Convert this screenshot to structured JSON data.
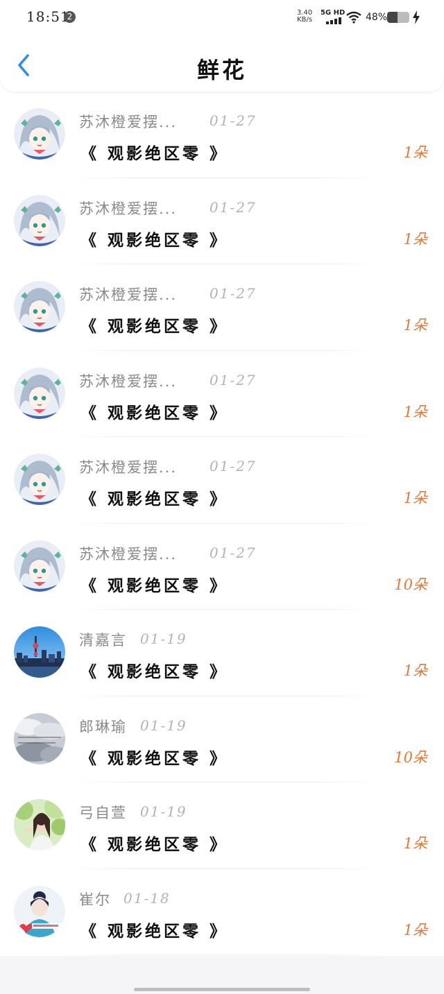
{
  "status_bar": {
    "time": "18:51",
    "notification_count": "2",
    "net_speed_value": "3.40",
    "net_speed_unit": "KB/s",
    "network": "5G HD",
    "battery_percent": "48%",
    "battery_level": 0.48,
    "charging": true
  },
  "header": {
    "title": "鲜花",
    "back_icon": "chevron-left-icon"
  },
  "colors": {
    "accent_back": "#2f8fe0",
    "count_orange": "#e07a3b",
    "name_gray": "#8a8a8a",
    "date_gray": "#b3b3b3"
  },
  "records": [
    {
      "user": "苏沐橙爱摆...",
      "date": "01-27",
      "title": "《 观影绝区零 》",
      "count": "1朵",
      "avatar": "anime-girl-avatar"
    },
    {
      "user": "苏沐橙爱摆...",
      "date": "01-27",
      "title": "《 观影绝区零 》",
      "count": "1朵",
      "avatar": "anime-girl-avatar"
    },
    {
      "user": "苏沐橙爱摆...",
      "date": "01-27",
      "title": "《 观影绝区零 》",
      "count": "1朵",
      "avatar": "anime-girl-avatar"
    },
    {
      "user": "苏沐橙爱摆...",
      "date": "01-27",
      "title": "《 观影绝区零 》",
      "count": "1朵",
      "avatar": "anime-girl-avatar"
    },
    {
      "user": "苏沐橙爱摆...",
      "date": "01-27",
      "title": "《 观影绝区零 》",
      "count": "1朵",
      "avatar": "anime-girl-avatar"
    },
    {
      "user": "苏沐橙爱摆...",
      "date": "01-27",
      "title": "《 观影绝区零 》",
      "count": "10朵",
      "avatar": "anime-girl-avatar"
    },
    {
      "user": "清嘉言",
      "date": "01-19",
      "title": "《 观影绝区零 》",
      "count": "1朵",
      "avatar": "city-skyline-avatar"
    },
    {
      "user": "郎琳瑜",
      "date": "01-19",
      "title": "《 观影绝区零 》",
      "count": "10朵",
      "avatar": "cloudy-sky-avatar"
    },
    {
      "user": "弓自萱",
      "date": "01-19",
      "title": "《 观影绝区零 》",
      "count": "1朵",
      "avatar": "girl-in-garden-avatar"
    },
    {
      "user": "崔尔",
      "date": "01-18",
      "title": "《 观影绝区零 》",
      "count": "1朵",
      "avatar": "girl-with-heart-avatar"
    }
  ]
}
